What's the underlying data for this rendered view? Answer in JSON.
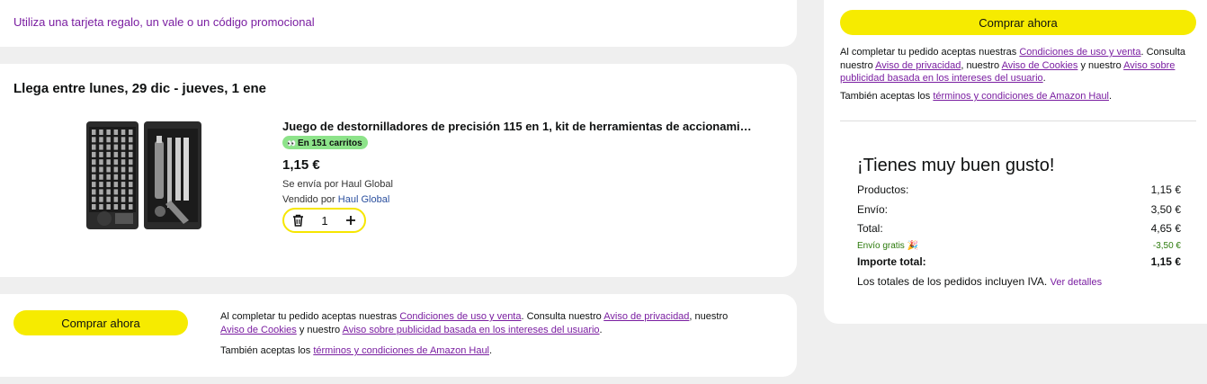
{
  "promo": {
    "link": "Utiliza una tarjeta regalo, un vale o un código promocional"
  },
  "item": {
    "delivery": "Llega entre lunes, 29 dic - jueves, 1 ene",
    "title": "Juego de destornilladores de precisión 115 en 1, kit de herramientas de accionami…",
    "badge": "En 151 carritos",
    "price": "1,15 €",
    "shipped_by": "Se envía por Haul Global",
    "sold_by_prefix": "Vendido por ",
    "seller": "Haul Global",
    "quantity": "1"
  },
  "checkout": {
    "buy_label": "Comprar ahora",
    "terms_p1": "Al completar tu pedido aceptas nuestras ",
    "terms_l1": "Condiciones de uso y venta",
    "terms_p2": ". Consulta nuestro ",
    "terms_l2": "Aviso de privacidad",
    "terms_p3": ", nuestro ",
    "terms_l3": "Aviso de Cookies",
    "terms_p4": " y nuestro ",
    "terms_l4": "Aviso sobre publicidad basada en los intereses del usuario",
    "terms_p5": ".",
    "also_p1": "También aceptas los ",
    "also_l1": "términos y condiciones de Amazon Haul",
    "also_p2": "."
  },
  "summary": {
    "title": "¡Tienes muy buen gusto!",
    "products_label": "Productos:",
    "products_value": "1,15 €",
    "shipping_label": "Envío:",
    "shipping_value": "3,50 €",
    "total_label": "Total:",
    "total_value": "4,65 €",
    "free_label": "Envío gratis",
    "free_value": "-3,50 €",
    "grand_label": "Importe total:",
    "grand_value": "1,15 €",
    "iva_text": "Los totales de los pedidos incluyen IVA.",
    "details_link": "Ver detalles"
  },
  "colors": {
    "accent_yellow": "#f6eb00",
    "link_purple": "#7a1ea1",
    "badge_green": "#8de38a",
    "discount_green": "#2b7a0b"
  }
}
